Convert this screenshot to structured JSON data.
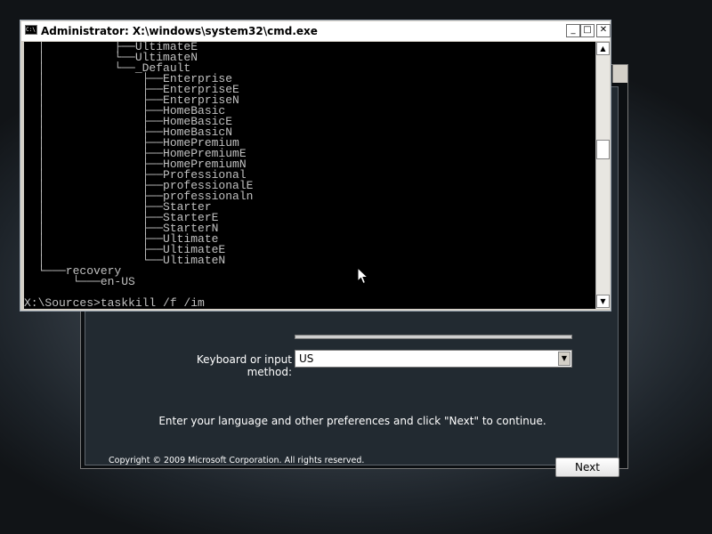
{
  "cmd": {
    "title": "Administrator: X:\\windows\\system32\\cmd.exe",
    "icon_text": "C:\\",
    "minimize": "_",
    "maximize": "□",
    "close": "✕",
    "lines": [
      "  │          ├──UltimateE",
      "  │          └──UltimateN",
      "  │          └──_Default",
      "  │              ├──Enterprise",
      "  │              ├──EnterpriseE",
      "  │              ├──EnterpriseN",
      "  │              ├──HomeBasic",
      "  │              ├──HomeBasicE",
      "  │              ├──HomeBasicN",
      "  │              ├──HomePremium",
      "  │              ├──HomePremiumE",
      "  │              ├──HomePremiumN",
      "  │              ├──Professional",
      "  │              ├──professionalE",
      "  │              ├──professionaln",
      "  │              ├──Starter",
      "  │              ├──StarterE",
      "  │              ├──StarterN",
      "  │              ├──Ultimate",
      "  │              ├──UltimateE",
      "  │              └──UltimateN",
      "  └───recovery",
      "       └───en-US"
    ],
    "prompt": "X:\\Sources>taskkill /f /im",
    "scroll_up": "▲",
    "scroll_down": "▼"
  },
  "setup": {
    "keyboard_label": "Keyboard or input method:",
    "keyboard_value": "US",
    "dropdown_arrow": "▼",
    "instruction": "Enter your language and other preferences and click \"Next\" to continue.",
    "copyright": "Copyright © 2009 Microsoft Corporation. All rights reserved.",
    "next_label": "Next"
  },
  "icons": {
    "cursor": "mouse-pointer-icon",
    "console": "console-icon"
  }
}
